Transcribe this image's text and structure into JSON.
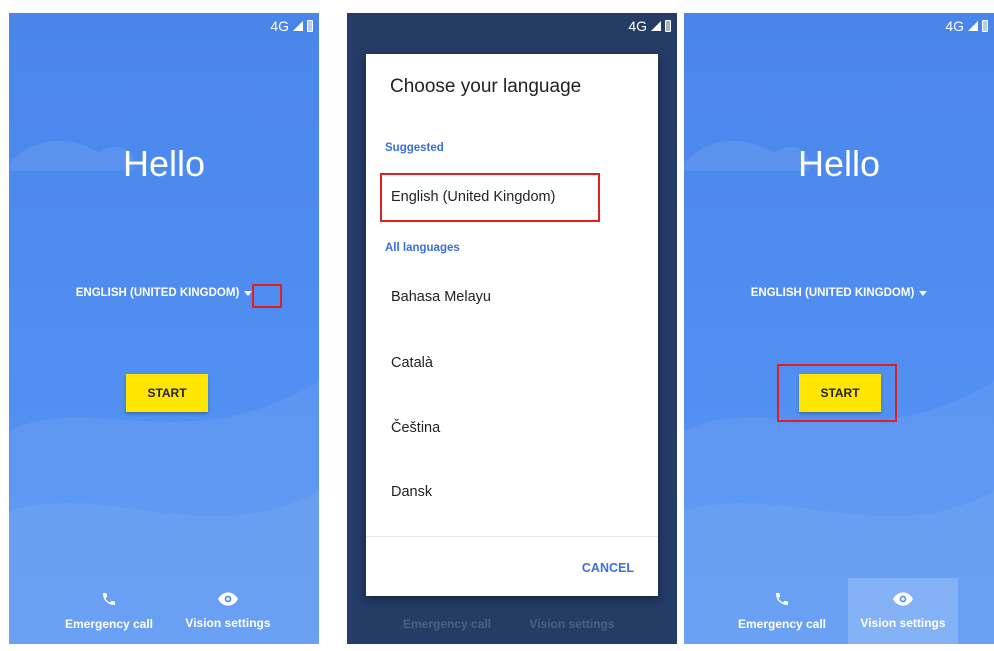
{
  "status_bar": {
    "network": "4G"
  },
  "welcome": {
    "greeting": "Hello",
    "language": "ENGLISH (UNITED KINGDOM)",
    "start_label": "START"
  },
  "bottom": {
    "emergency_label": "Emergency call",
    "vision_label": "Vision settings"
  },
  "language_dialog": {
    "title": "Choose your language",
    "suggested_header": "Suggested",
    "suggested": [
      "English (United Kingdom)"
    ],
    "all_header": "All languages",
    "languages": [
      "Bahasa Melayu",
      "Català",
      "Čeština",
      "Dansk"
    ],
    "cancel_label": "CANCEL"
  },
  "colors": {
    "background_blue": "#4f8cf0",
    "start_yellow": "#ffe600",
    "accent_blue": "#3b6fdb",
    "highlight_red": "#e02020"
  }
}
